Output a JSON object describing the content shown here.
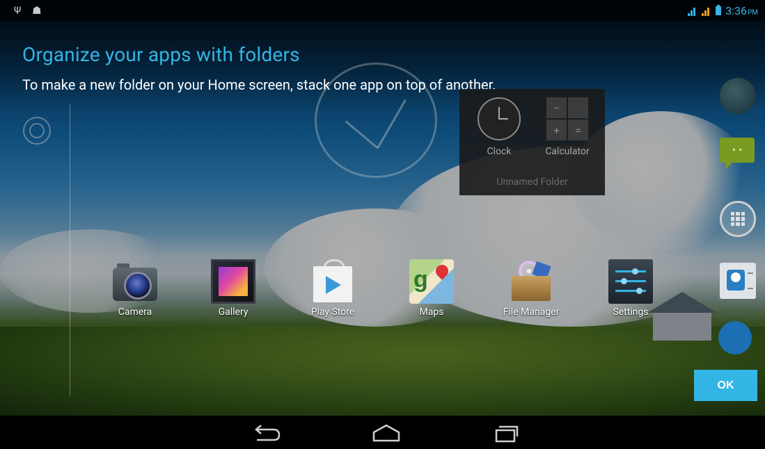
{
  "status_bar": {
    "left_icons": [
      "usb-icon",
      "android-debug-icon"
    ],
    "time": "3:36",
    "ampm": "PM",
    "accent_color": "#33b5e5"
  },
  "cling": {
    "title": "Organize your apps with folders",
    "body": "To make a new folder on your Home screen, stack one app on top of another.",
    "ok_label": "OK"
  },
  "folder": {
    "name": "Unnamed Folder",
    "apps": [
      {
        "label": "Clock",
        "icon": "clock-icon"
      },
      {
        "label": "Calculator",
        "icon": "calculator-icon"
      }
    ]
  },
  "calculator_keys": [
    "−",
    "",
    "+",
    "="
  ],
  "apps": [
    {
      "label": "Camera",
      "icon": "camera-icon"
    },
    {
      "label": "Gallery",
      "icon": "gallery-icon"
    },
    {
      "label": "Play Store",
      "icon": "play-store-icon"
    },
    {
      "label": "Maps",
      "icon": "maps-icon"
    },
    {
      "label": "File Manager",
      "icon": "file-manager-icon"
    },
    {
      "label": "Settings",
      "icon": "settings-icon"
    }
  ],
  "dock": [
    "browser-icon",
    "messaging-icon",
    "app-launcher-icon",
    "contacts-icon",
    "phone-icon"
  ],
  "nav": [
    "back-icon",
    "home-icon",
    "recent-apps-icon"
  ]
}
